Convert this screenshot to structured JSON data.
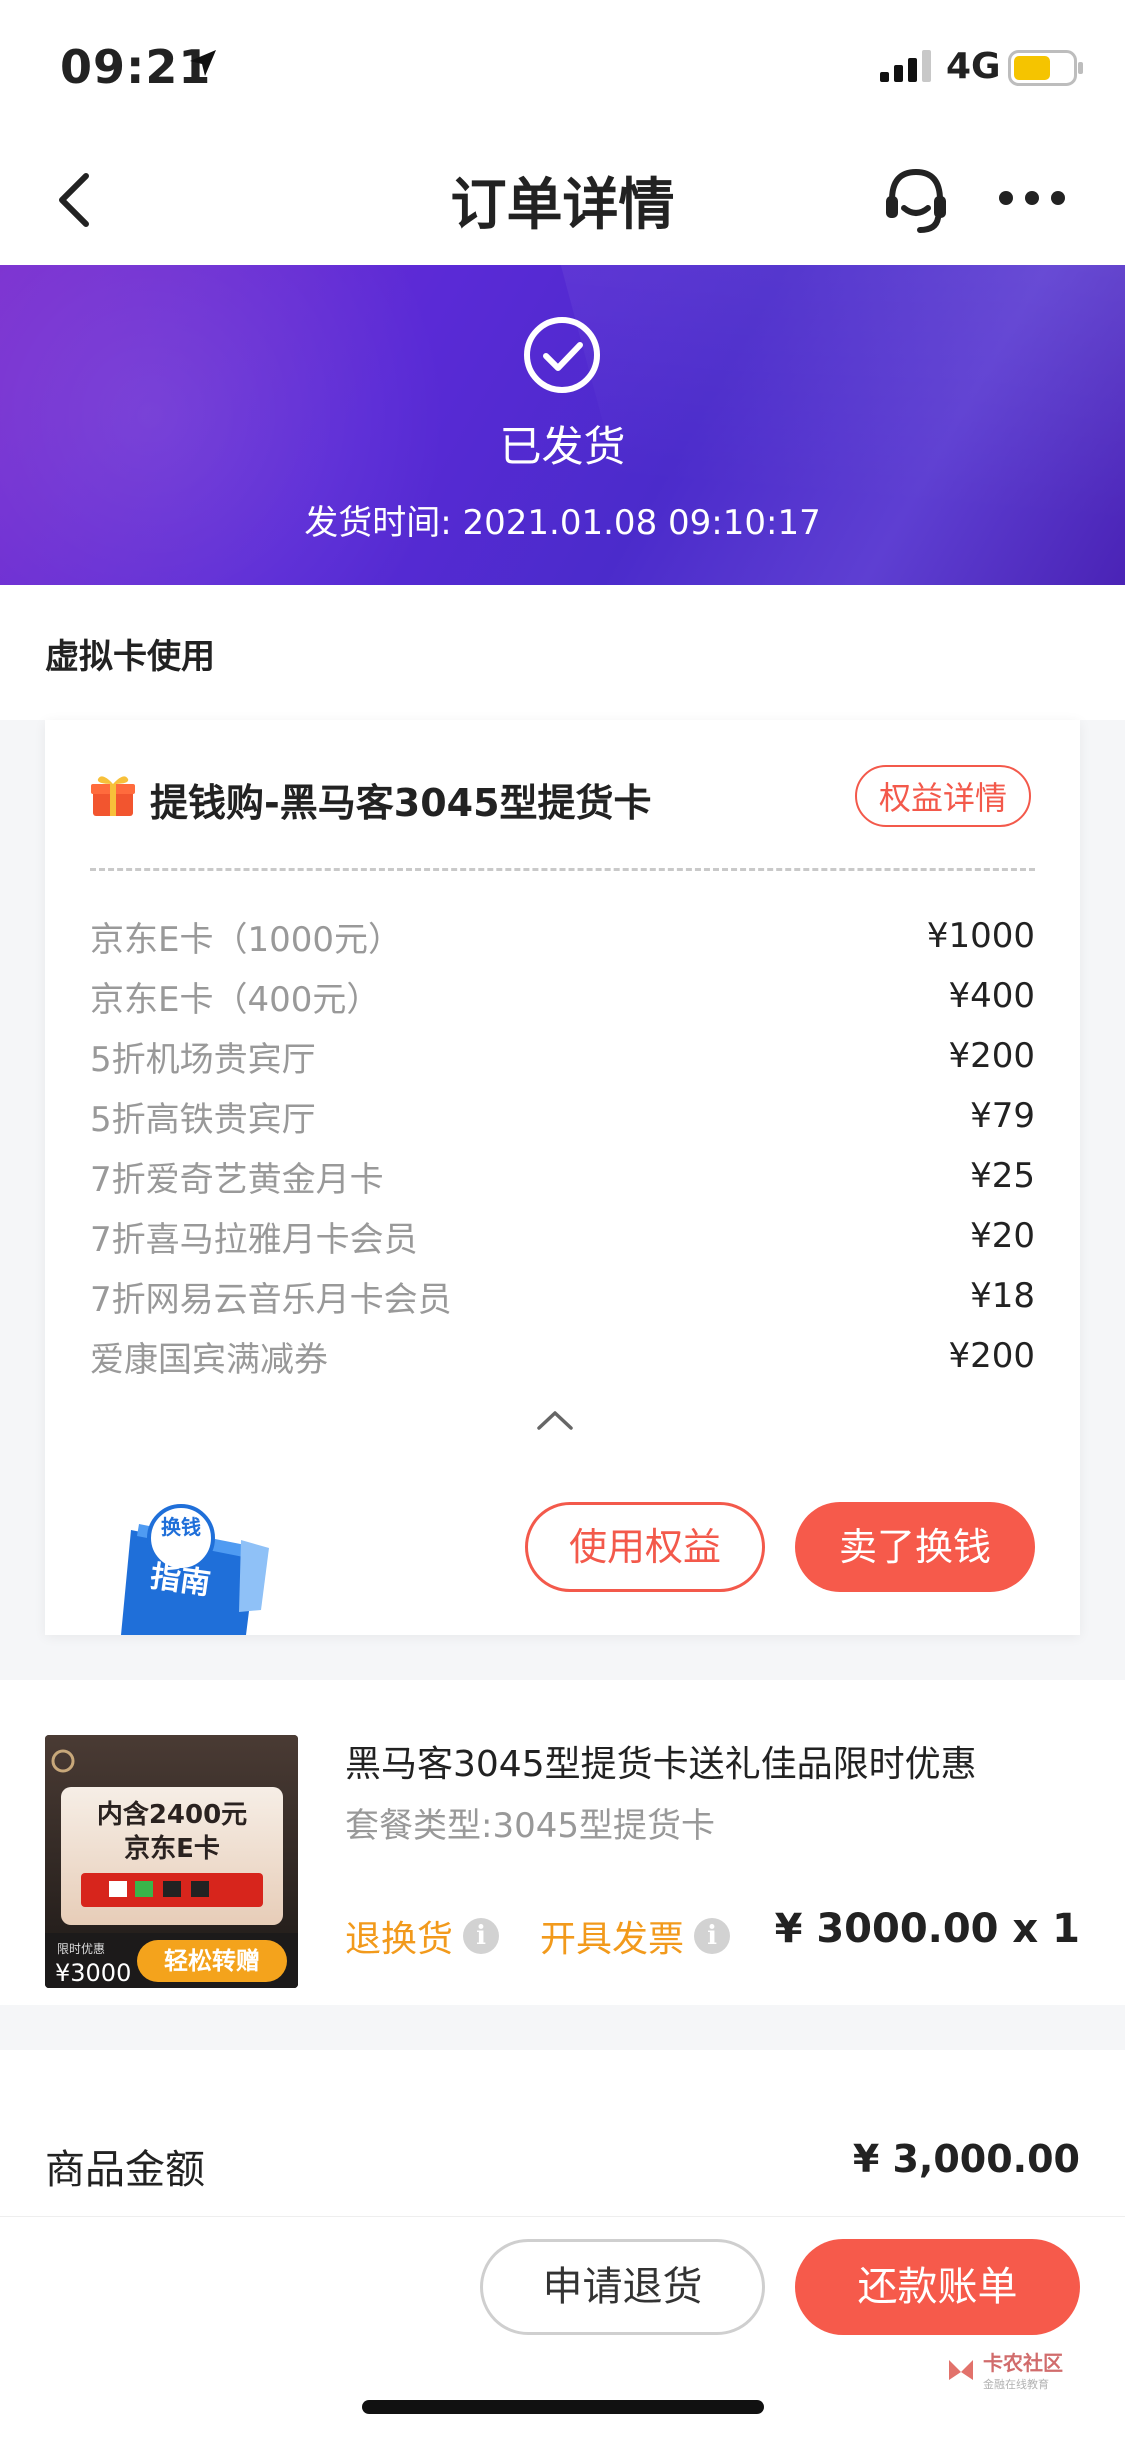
{
  "status_bar": {
    "time": "09:21",
    "network": "4G"
  },
  "nav": {
    "title": "订单详情"
  },
  "banner": {
    "status": "已发货",
    "ship_time": "发货时间: 2021.01.08 09:10:17"
  },
  "virtual_card": {
    "section_title": "虚拟卡使用",
    "card_title": "提钱购-黑马客3045型提货卡",
    "detail_button": "权益详情",
    "benefits": [
      {
        "name": "京东E卡（1000元）",
        "price": "¥1000"
      },
      {
        "name": "京东E卡（400元）",
        "price": "¥400"
      },
      {
        "name": "5折机场贵宾厅",
        "price": "¥200"
      },
      {
        "name": "5折高铁贵宾厅",
        "price": "¥79"
      },
      {
        "name": "7折爱奇艺黄金月卡",
        "price": "¥25"
      },
      {
        "name": "7折喜马拉雅月卡会员",
        "price": "¥20"
      },
      {
        "name": "7折网易云音乐月卡会员",
        "price": "¥18"
      },
      {
        "name": "爱康国宾满减券",
        "price": "¥200"
      }
    ],
    "guide_badge_text": "换钱指南",
    "use_button": "使用权益",
    "sell_button": "卖了换钱"
  },
  "product": {
    "image_text": {
      "line1": "内含2400元",
      "line2": "京东E卡",
      "tag": "限时优惠",
      "price": "¥3000",
      "cta": "轻松转赠"
    },
    "name": "黑马客3045型提货卡送礼佳品限时优惠",
    "type": "套餐类型:3045型提货卡",
    "return_label": "退换货",
    "invoice_label": "开具发票",
    "price": "¥ 3000.00 x 1"
  },
  "amount": {
    "label": "商品金额",
    "value": "¥ 3,000.00"
  },
  "bottom": {
    "refund_button": "申请退货",
    "bill_button": "还款账单",
    "watermark_main": "卡农社区",
    "watermark_sub": "金融在线教育"
  },
  "colors": {
    "accent": "#f65a4b",
    "banner": "#5a2ad6",
    "warning": "#f29a1c"
  }
}
